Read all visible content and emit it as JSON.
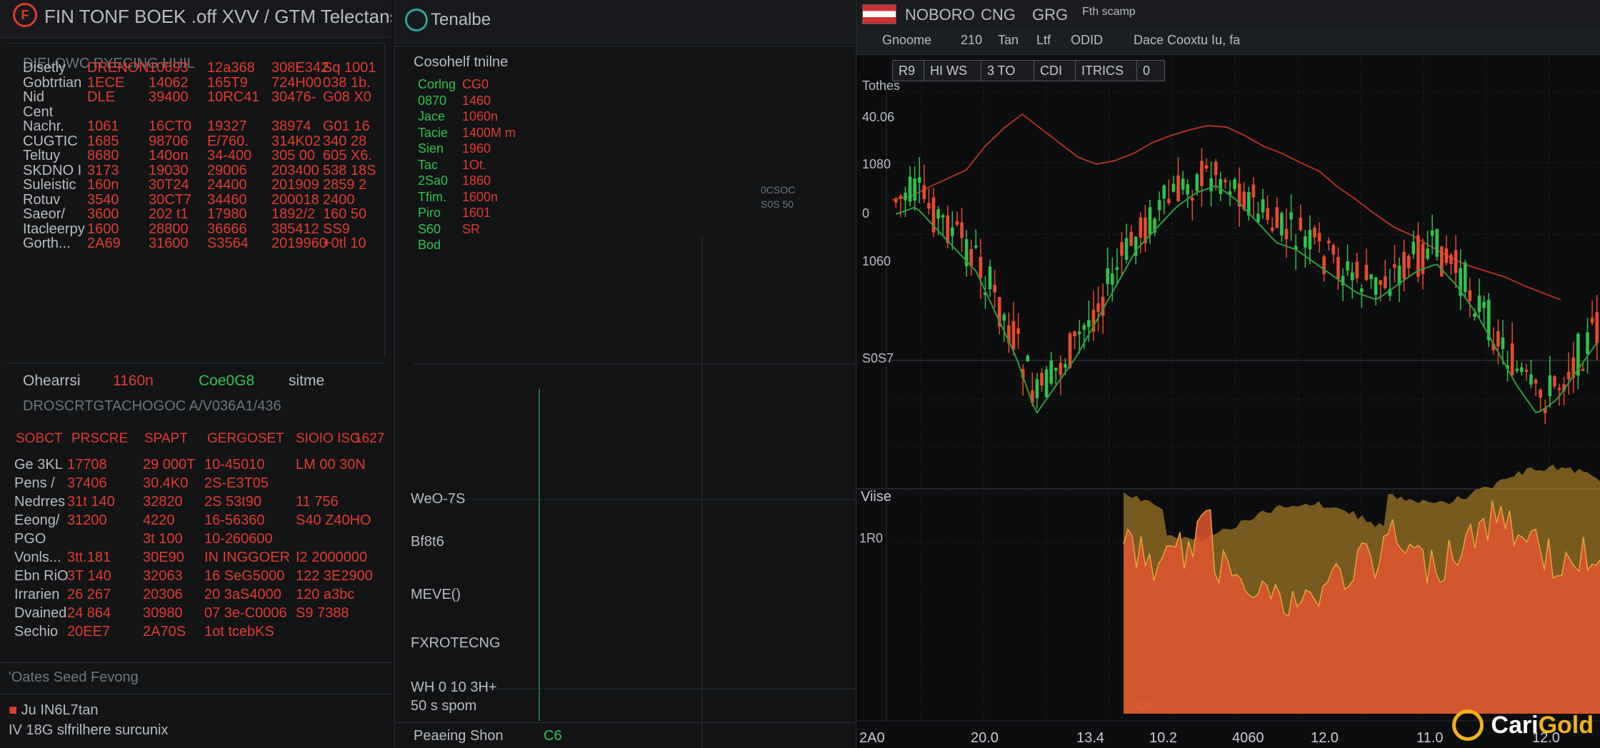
{
  "left_panel": {
    "title": "FIN TONF BOEK .off XVV / GTM Telectans",
    "subtitle": "DIELOWC RYECING HHIL",
    "subtitle_right": "ol",
    "top_table": {
      "rows": [
        [
          "Disetly",
          "DRENON",
          "10693",
          "12a368",
          "308E342",
          "Sq 1001"
        ],
        [
          "Gobtrtian",
          "1ECE",
          "14062",
          "165T9",
          "724H00",
          "038 1b."
        ],
        [
          "Nid",
          "DLE",
          "39400",
          "10RC41",
          "30476-",
          "G08 X0"
        ],
        [
          "Cent",
          "",
          "",
          "",
          "",
          ""
        ],
        [
          "Nachr.",
          "1061",
          "16CT0",
          "19327",
          "38974",
          "G01 16"
        ],
        [
          "CUGTIC",
          "1685",
          "98706",
          "E/760.",
          "314K02",
          "340 28"
        ],
        [
          "Teltuy",
          "8680",
          "140on",
          "34-400",
          "305 00",
          "605 X6."
        ],
        [
          "SKDNO I",
          "3173",
          "19030",
          "29006",
          "203400",
          "538 18S"
        ],
        [
          "Suleistic",
          "160n",
          "30T24",
          "24400",
          "201909",
          "2859 2"
        ],
        [
          "Rotuv",
          "3540",
          "30CT7",
          "34460",
          "200018",
          "2400"
        ],
        [
          "Saeor/",
          "3600",
          "202 t1",
          "17980",
          "1892/2",
          "160 50"
        ],
        [
          "Itacleerpy",
          "1600",
          "28800",
          "36666",
          "385412",
          "SS9"
        ],
        [
          "Gorth...",
          "2A69",
          "31600",
          "S3564",
          "2019960",
          "+0tl 10"
        ]
      ]
    },
    "mid_labels": {
      "a": "Ohearrsi",
      "b": "1160n",
      "c": "Coe0G8",
      "d": "sitme"
    },
    "mid_caption": "DROSCRTGTACHOGOC  A/V036A1/436",
    "bottom_table": {
      "headers": [
        "SOBCT",
        "PRSCRE",
        "SPAPT",
        "GERGOSET",
        "SIOIO ISG",
        "1627"
      ],
      "rows": [
        [
          "Ge 3KL",
          "17708",
          "29 000T",
          "10-45010",
          "LM 00 30N"
        ],
        [
          "Pens /",
          "37406",
          "30.4K0",
          "2S-E3T05",
          ""
        ],
        [
          "Nedrres",
          "31t 140",
          "32820",
          "2S 53t90",
          "11 756"
        ],
        [
          "Eeong/",
          "31200",
          "4220",
          "16-56360",
          "S40 Z40HO"
        ],
        [
          "PGO",
          "",
          "3t 100",
          "10-260600",
          ""
        ],
        [
          "Vonls...",
          "3tt.181",
          "30E90",
          "IN INGGOER",
          "I2 2000000"
        ],
        [
          "Ebn RiO",
          "3T 140",
          "32063",
          "16 SeG5000",
          "122 3E2900"
        ],
        [
          "Irrarien",
          "26 267",
          "20306",
          "20 3aS4000",
          "120 a3bc"
        ],
        [
          "Dvained",
          "24 864",
          "30980",
          "07 3e-C0006",
          "S9 7388"
        ],
        [
          "Sechio",
          "20EE7",
          "2A70S",
          "1ot tcebKS",
          ""
        ]
      ]
    },
    "footer": {
      "caption": "'Oates Seed Fevong",
      "line1": "Ju IN6L7tan",
      "line2": "IV 18G slfrilhere surcunix"
    }
  },
  "mid_panel": {
    "title": "Tenalbe",
    "section_title": "Cosohelf tnilne",
    "items": [
      {
        "label": "Corlng",
        "value": "CG0"
      },
      {
        "label": "0870",
        "value": "1460"
      },
      {
        "label": "Jace",
        "value": "1060n"
      },
      {
        "label": "Tacie",
        "value": "1400M m"
      },
      {
        "label": "Sien",
        "value": "1960"
      },
      {
        "label": "Tac",
        "value": "1Ot."
      },
      {
        "label": "2Sa0",
        "value": "1860"
      },
      {
        "label": "Tfim.",
        "value": "1600n"
      },
      {
        "label": "Piro",
        "value": "1601"
      },
      {
        "label": "S60",
        "value": "SR"
      },
      {
        "label": "Bod",
        "value": ""
      }
    ],
    "tiny_note_1": "0CSOC",
    "tiny_note_2": "S0S 50",
    "lower_labels": [
      "WeO-7S",
      "Bf8t6",
      "MEVE()",
      "FXROTECNG",
      "WH  0 10 3H+",
      "50  s  spom"
    ],
    "bottom_label": "Peaeing Shon",
    "bottom_value": "C6"
  },
  "right_panel": {
    "top_tabs": [
      "NOBORO",
      "CNG",
      "GRG",
      "Fth scamp"
    ],
    "toolbar_items": [
      "Gnoome",
      "210",
      "Tan",
      "Ltf",
      "ODID",
      "Dace Cooxtu Iu, fa"
    ],
    "sub_tabs": [
      "R9",
      "HI WS",
      "3 TO",
      "CDI",
      "ITRICS",
      "0"
    ],
    "y_labels": [
      "Tothes",
      "40.06",
      "1080",
      "0",
      "1060",
      "S0S7"
    ],
    "volume_label": "Viise",
    "volume_y": "1R0",
    "volume_min": "C0",
    "x_labels": [
      "2A0",
      "20.0",
      "13.4",
      "10.2",
      "4060",
      "12.0",
      "11.0",
      "12.0"
    ],
    "watermark_text_a": "Cari",
    "watermark_text_b": "Gold",
    "colors": {
      "up": "#2fc14b",
      "down": "#e84a2c",
      "area": "#e05530",
      "area_top": "#d09a2f"
    }
  }
}
